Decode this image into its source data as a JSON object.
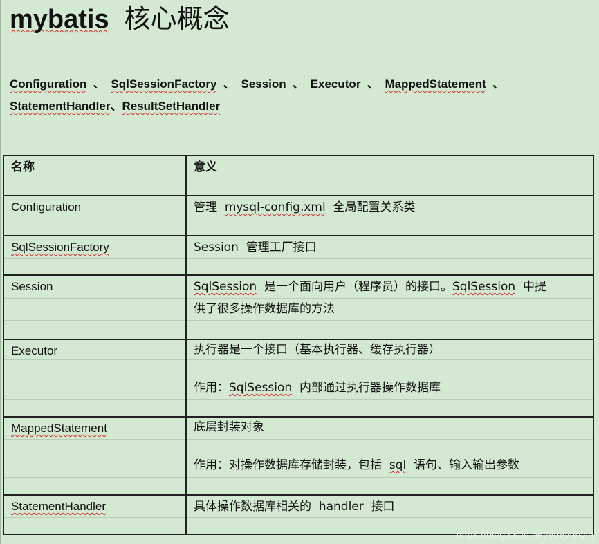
{
  "title": {
    "en": "mybatis",
    "cn": "核心概念"
  },
  "concepts": {
    "line1": [
      "Configuration",
      "SqlSessionFactory",
      "Session",
      "Executor",
      "MappedStatement"
    ],
    "sep": "、",
    "line2_a": "StatementHandler",
    "line2_b": "ResultSetHandler"
  },
  "table": {
    "headers": [
      "名称",
      "意义"
    ],
    "rows": [
      {
        "name": "Configuration",
        "meaning_pre": "管理",
        "meaning_term": "mysql-config.xml",
        "meaning_post": "全局配置关系类"
      },
      {
        "name": "SqlSessionFactory",
        "meaning_pre": "Session",
        "meaning_post": "管理工厂接口"
      },
      {
        "name": "Session",
        "meaning_l1_term": "SqlSession",
        "meaning_l1_mid": "是一个面向用户（程序员）的接口。",
        "meaning_l1_term2": "SqlSession",
        "meaning_l1_end": "中提",
        "meaning_l2": "供了很多操作数据库的方法"
      },
      {
        "name": "Executor",
        "meaning_l1": "执行器是一个接口（基本执行器、缓存执行器）",
        "meaning_l2_pre": "作用：",
        "meaning_l2_term": "SqlSession",
        "meaning_l2_post": "内部通过执行器操作数据库"
      },
      {
        "name": "MappedStatement",
        "meaning_l1": "底层封装对象",
        "meaning_l2_pre": "作用：对操作数据库存储封装，包括",
        "meaning_l2_term": "sql",
        "meaning_l2_post": "语句、输入输出参数"
      },
      {
        "name": "StatementHandler",
        "meaning_pre": "具体操作数据库相关的",
        "meaning_term": "handler",
        "meaning_post": "接口"
      }
    ]
  },
  "watermark": "https://blog.csdn.net/yueyunyin"
}
